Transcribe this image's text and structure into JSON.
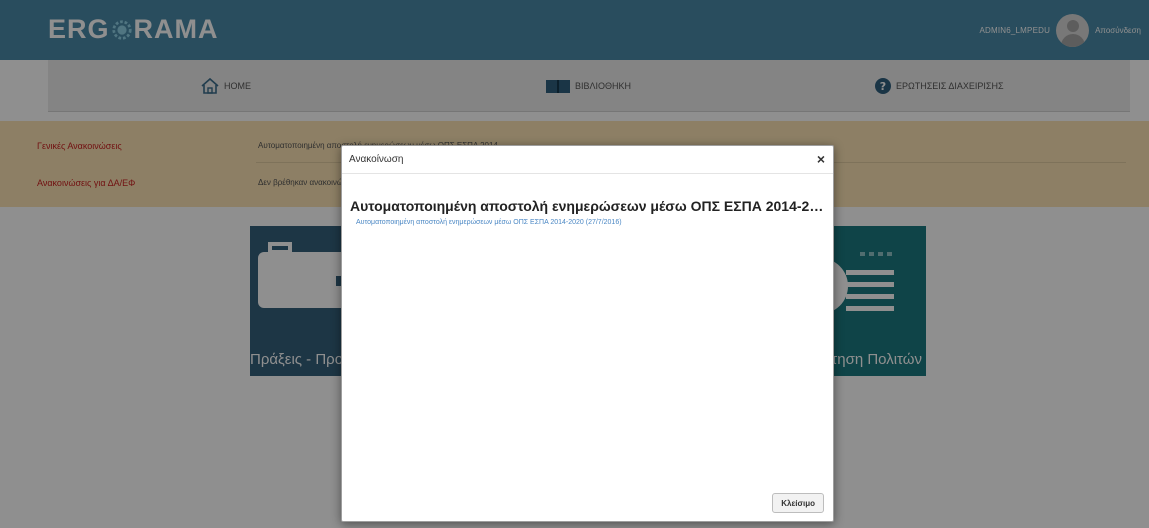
{
  "header": {
    "logo_left": "ERG",
    "logo_right": "RAMA",
    "username": "ADMIN6_LMPEDU",
    "logout": "Αποσύνδεση"
  },
  "nav": {
    "home": "HOME",
    "library": "ΒΙΒΛΙΟΘΗΚΗ",
    "faq": "ΕΡΩΤΗΣΕΙΣ ΔΙΑΧΕΙΡΙΣΗΣ"
  },
  "announcements": {
    "general_label": "Γενικές Ανακοινώσεις",
    "general_text": "Αυτοματοποιημένη αποστολή ενημερώσεων μέσω ΟΠΣ ΕΣΠΑ 2014",
    "daef_label": "Ανακοινώσεις για ΔΑ/ΕΦ",
    "daef_text": "Δεν βρέθηκαν ανακοινώσεις"
  },
  "tiles": {
    "actions_label": "Πράξεις - Προγράμματα",
    "citizens_label": "Εξυπηρέτηση Πολιτών"
  },
  "modal": {
    "title": "Ανακοίνωση",
    "close_symbol": "×",
    "heading": "Αυτοματοποιημένη αποστολή ενημερώσεων μέσω ΟΠΣ ΕΣΠΑ 2014-202...",
    "link": "Αυτοματοποιημένη αποστολή ενημερώσεων μέσω ΟΠΣ ΕΣΠΑ 2014-2020 (27/7/2016)",
    "close_button": "Κλείσιμο"
  },
  "colors": {
    "header_bg": "#4a8aa8",
    "nav_bg": "#ececec",
    "announcement_bg": "#fbe3b4",
    "announcement_label": "#cc2222",
    "tile_actions": "#34617c",
    "tile_citizens": "#1c7a80",
    "link": "#4a87c4"
  }
}
